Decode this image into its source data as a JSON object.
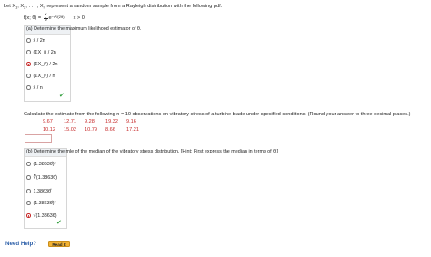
{
  "intro": {
    "lead": "Let X",
    "s1": "1",
    "mid1": ", X",
    "s2": "2",
    "mid2": ", . . . , X",
    "sn": "n",
    "tail": " represent a random sample from a Rayleigh distribution with the following pdf."
  },
  "pdf": {
    "lhs": "f(x; θ) =",
    "frac_top": "x",
    "frac_bot": "θ",
    "exp_base": "e",
    "exp": "−x²/(2θ)",
    "cond": "x > 0"
  },
  "part_a": {
    "title": "(a) Determine the maximum likelihood estimator of θ.",
    "options": [
      "x̄ / 2n",
      "(ΣX_i) / 2n",
      "(ΣX_i²) / 2n",
      "(ΣX_i²) / n",
      "x̄ / n"
    ],
    "selected_index": 2,
    "status": "correct"
  },
  "data_prompt": "Calculate the estimate from the following n = 10 observations on vibratory stress of a turbine blade under specified conditions. (Round your answer to three decimal places.)",
  "observations": {
    "row1": [
      "9.67",
      "12.71",
      "9.28",
      "19.32",
      "9.16"
    ],
    "row2": [
      "10.12",
      "15.02",
      "10.79",
      "8.66",
      "17.21"
    ]
  },
  "part_b": {
    "title": "(b) Determine the mle of the median of the vibratory stress distribution. [Hint: First express the median in terms of θ.]",
    "options": [
      "(1.3863θ̂)²",
      "∛(1.3863θ̂)",
      "1.3863θ̂",
      "(1.3863θ̂)²",
      "√(1.3863θ̂)"
    ],
    "selected_index": 4,
    "status": "correct"
  },
  "help": {
    "label": "Need Help?",
    "read_button": "Read It"
  },
  "colors": {
    "accent_red": "#c62828",
    "correct_green": "#2e9d3a",
    "link_blue": "#2b5ea8",
    "button_orange": "#f2b233"
  }
}
